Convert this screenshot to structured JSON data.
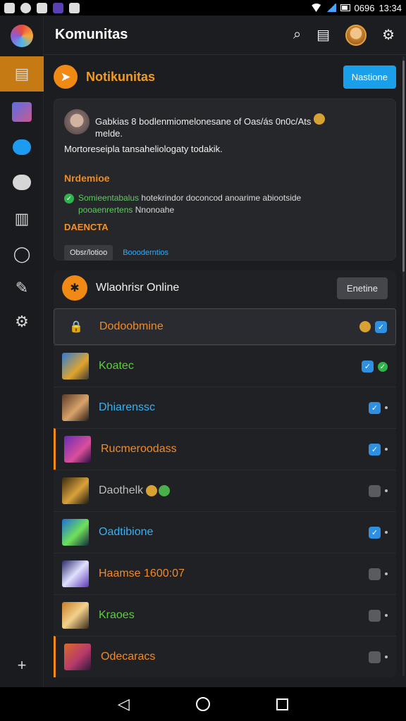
{
  "status_bar": {
    "time": "13:34",
    "battery_text": "0696"
  },
  "app": {
    "title": "Komunitas"
  },
  "announcement": {
    "title": "Notikunitas",
    "action_label": "Nastione"
  },
  "post": {
    "author_text": "Gabkias 8 bodlenmiomelonesane of Oas/ás 0n0c/Ats",
    "author_text2": "melde.",
    "body": "Mortoreseipla tansaheliologaty todakik.",
    "heading": "Nrdemioe",
    "check_text_a": "Somieentabalus",
    "check_text_b": "hotekrindor doconcod anoarime abiootside",
    "check_text_c": "pooaenrertens",
    "check_text_d": "Nnonoahe",
    "tag": "DAENCTA",
    "chip": "Obsr/lotioo",
    "chip_link": "Boooderntios"
  },
  "members": {
    "title": "Wlaohrisr Online",
    "action_label": "Enetine",
    "rows": [
      {
        "name": "Dodoobmine",
        "color": "#f08a2a",
        "kind": "locked"
      },
      {
        "name": "Koatec",
        "color": "#5ccf3a",
        "kind": "member"
      },
      {
        "name": "Dhiarenssc",
        "color": "#3ab0f0",
        "kind": "member"
      },
      {
        "name": "Rucmeroodass",
        "color": "#f08a2a",
        "kind": "member"
      },
      {
        "name": "Daothelk",
        "color": "#bdbdbd",
        "kind": "member"
      },
      {
        "name": "Oadtibione",
        "color": "#3ab0f0",
        "kind": "member"
      },
      {
        "name": "Haamse 1600:07",
        "color": "#f08a2a",
        "kind": "member"
      },
      {
        "name": "Kraoes",
        "color": "#5ccf3a",
        "kind": "member"
      },
      {
        "name": "Odecaracs",
        "color": "#f08a2a",
        "kind": "member"
      }
    ]
  },
  "icons": {
    "nav": [
      "rail-home-icon",
      "rail-community-icon",
      "rail-chat-icon",
      "rail-discord-icon",
      "rail-book-icon",
      "rail-search-icon",
      "rail-edit-icon",
      "rail-settings-icon",
      "rail-add-icon"
    ],
    "top": [
      "search-icon",
      "list-icon",
      "profile-avatar",
      "settings-icon"
    ]
  },
  "colors": {
    "accent": "#f08a14",
    "link": "#1aa0ea",
    "bg": "#1c1d21"
  }
}
